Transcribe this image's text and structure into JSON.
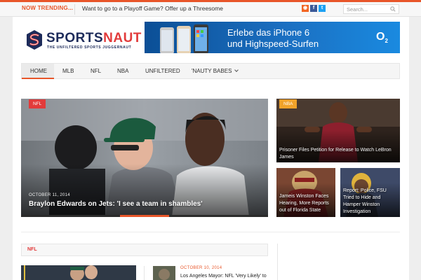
{
  "topbar": {
    "trending_label": "NOW TRENDING...",
    "trending_text": "Want to go to a Playoff Game? Offer up a Threesome",
    "search_placeholder": "Search..."
  },
  "brand": {
    "name_part1": "SPORTS",
    "name_part2": "NAUT",
    "tagline": "THE UNFILTERED SPORTS JUGGERNAUT"
  },
  "ad": {
    "line1": "Erlebe das iPhone 6",
    "line2": "und Highspeed-Surfen",
    "logo": "O",
    "logo_sub": "2"
  },
  "nav": {
    "items": [
      {
        "label": "HOME"
      },
      {
        "label": "MLB"
      },
      {
        "label": "NFL"
      },
      {
        "label": "NBA"
      },
      {
        "label": "UNFILTERED"
      },
      {
        "label": "'NAUTY BABES"
      }
    ]
  },
  "featured": {
    "tag": "NFL",
    "date": "OCTOBER 11, 2014",
    "title": "Braylon Edwards on Jets: 'I see a team in shambles'"
  },
  "side": [
    {
      "tag": "NBA",
      "title": "Prisoner Files Petition for Release to Watch LeBron James"
    },
    {
      "title": "Jameis Winston Faces Hearing, More Reports out of Florida State"
    },
    {
      "title": "Report: Police, FSU Tried to Hide and Hamper Winston Investigation"
    }
  ],
  "section": {
    "label": "NFL",
    "item_date": "OCTOBER 10, 2014",
    "item_title": "Los Angeles Mayor: NFL 'Very Likely' to"
  },
  "colors": {
    "accent": "#e8562a",
    "brand_red": "#e23b3b",
    "brand_navy": "#1d2b5a"
  }
}
